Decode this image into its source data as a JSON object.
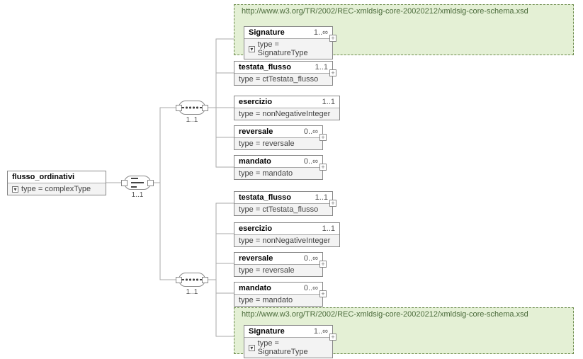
{
  "root": {
    "name": "flusso_ordinativi",
    "type": "type = complexType"
  },
  "choice": {
    "occ": "1..1"
  },
  "group1": {
    "seq_occ": "1..1",
    "import_url": "http://www.w3.org/TR/2002/REC-xmldsig-core-20020212/xmldsig-core-schema.xsd",
    "signature": {
      "name": "Signature",
      "occ": "1..∞",
      "type": "type = SignatureType"
    },
    "testata": {
      "name": "testata_flusso",
      "occ": "1..1",
      "type": "type = ctTestata_flusso"
    },
    "esercizio": {
      "name": "esercizio",
      "occ": "1..1",
      "type": "type = nonNegativeInteger"
    },
    "reversale": {
      "name": "reversale",
      "occ": "0..∞",
      "type": "type = reversale"
    },
    "mandato": {
      "name": "mandato",
      "occ": "0..∞",
      "type": "type = mandato"
    }
  },
  "group2": {
    "seq_occ": "1..1",
    "import_url": "http://www.w3.org/TR/2002/REC-xmldsig-core-20020212/xmldsig-core-schema.xsd",
    "testata": {
      "name": "testata_flusso",
      "occ": "1..1",
      "type": "type = ctTestata_flusso"
    },
    "esercizio": {
      "name": "esercizio",
      "occ": "1..1",
      "type": "type = nonNegativeInteger"
    },
    "reversale": {
      "name": "reversale",
      "occ": "0..∞",
      "type": "type = reversale"
    },
    "mandato": {
      "name": "mandato",
      "occ": "0..∞",
      "type": "type = mandato"
    },
    "signature": {
      "name": "Signature",
      "occ": "1..∞",
      "type": "type = SignatureType"
    }
  }
}
